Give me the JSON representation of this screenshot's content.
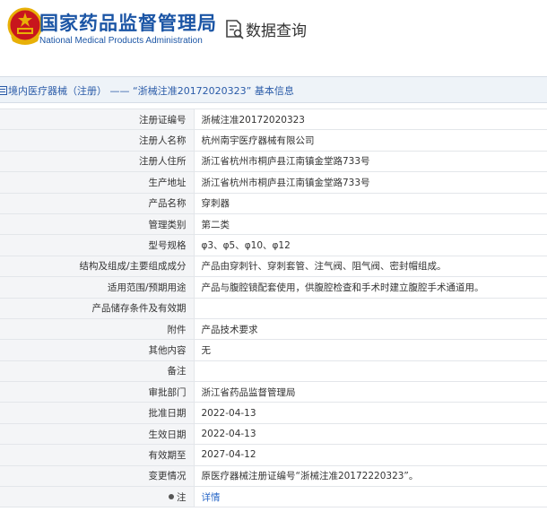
{
  "header": {
    "org_name_cn": "国家药品监督管理局",
    "org_name_en": "National Medical Products Administration",
    "query_title": "数据查询"
  },
  "breadcrumb": {
    "text": "境内医疗器械（注册） —— “浙械注准20172020323” 基本信息"
  },
  "rows": [
    {
      "label": "注册证编号",
      "value": "浙械注准20172020323"
    },
    {
      "label": "注册人名称",
      "value": "杭州南宇医疗器械有限公司"
    },
    {
      "label": "注册人住所",
      "value": "浙江省杭州市桐庐县江南镇金堂路733号"
    },
    {
      "label": "生产地址",
      "value": "浙江省杭州市桐庐县江南镇金堂路733号"
    },
    {
      "label": "产品名称",
      "value": "穿刺器"
    },
    {
      "label": "管理类别",
      "value": "第二类"
    },
    {
      "label": "型号规格",
      "value": "φ3、φ5、φ10、φ12"
    },
    {
      "label": "结构及组成/主要组成成分",
      "value": "产品由穿刺针、穿刺套管、注气阀、阻气阀、密封帽组成。"
    },
    {
      "label": "适用范围/预期用途",
      "value": "产品与腹腔镜配套使用，供腹腔检查和手术时建立腹腔手术通道用。"
    },
    {
      "label": "产品储存条件及有效期",
      "value": ""
    },
    {
      "label": "附件",
      "value": "产品技术要求"
    },
    {
      "label": "其他内容",
      "value": "无"
    },
    {
      "label": "备注",
      "value": ""
    },
    {
      "label": "审批部门",
      "value": "浙江省药品监督管理局"
    },
    {
      "label": "批准日期",
      "value": "2022-04-13"
    },
    {
      "label": "生效日期",
      "value": "2022-04-13"
    },
    {
      "label": "有效期至",
      "value": "2027-04-12"
    },
    {
      "label": "变更情况",
      "value": "原医疗器械注册证编号“浙械注准20172220323”。"
    }
  ],
  "note_row": {
    "label": "注",
    "link_text": "详情"
  },
  "colors": {
    "brand_blue": "#1b55a5",
    "emblem_red": "#c8161d",
    "emblem_gold": "#e8b007",
    "link_blue": "#2a68c8"
  },
  "icons": {
    "emblem": "national-emblem",
    "query": "document-search-icon",
    "crumb": "list-icon"
  }
}
